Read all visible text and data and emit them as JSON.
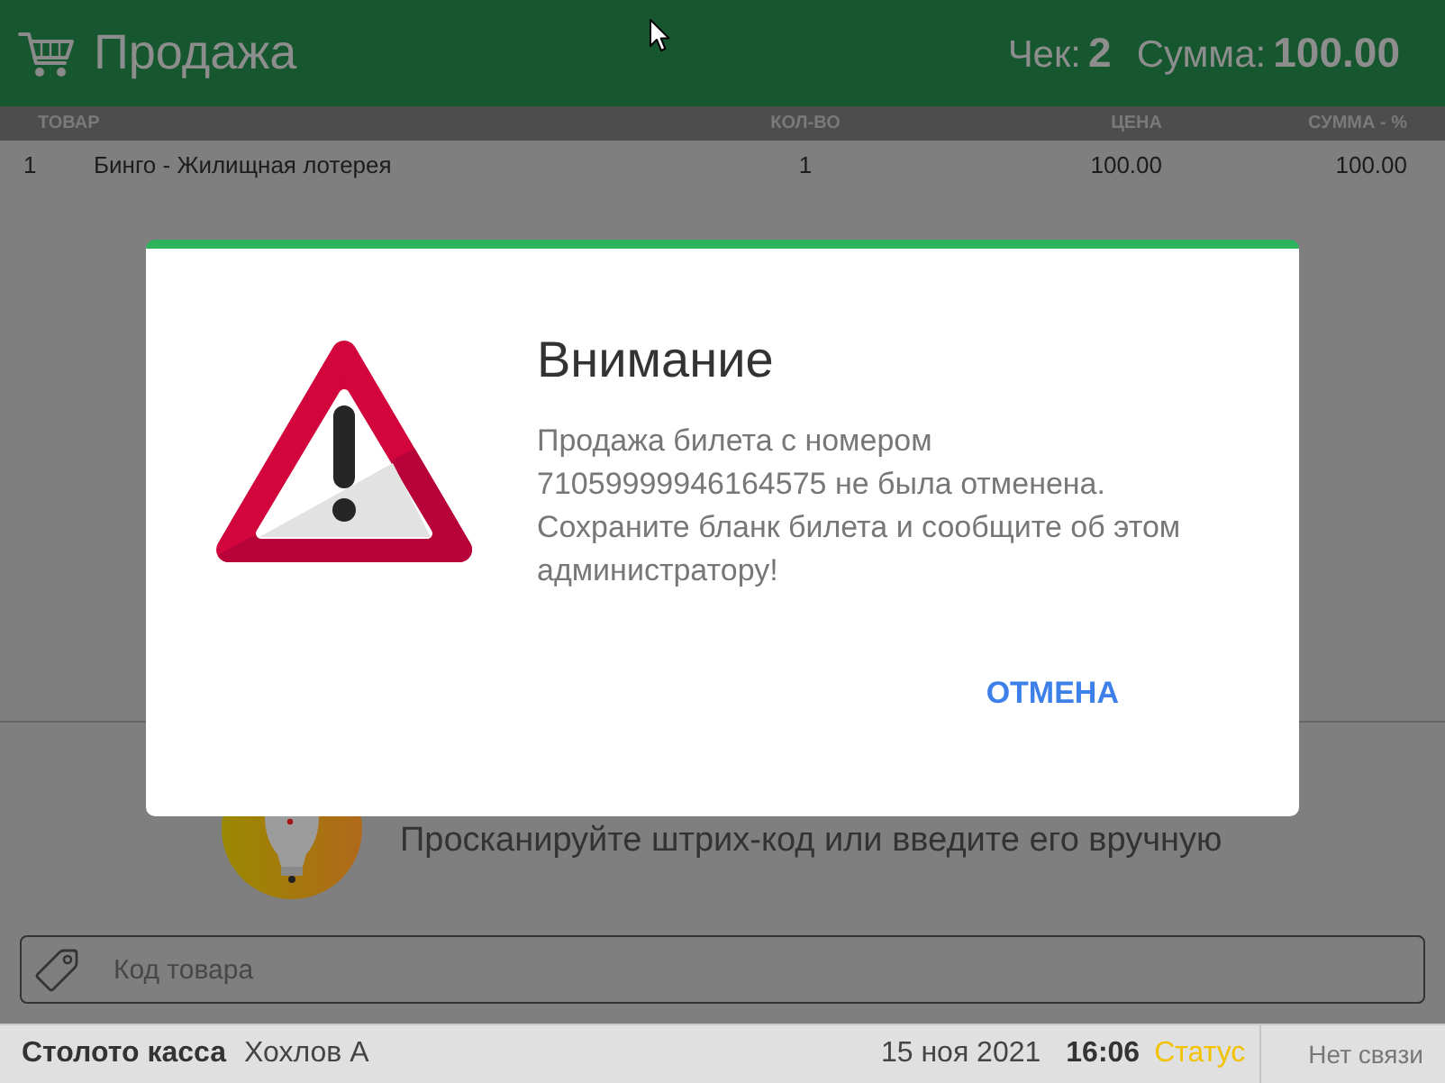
{
  "header": {
    "title": "Продажа",
    "receipt_label": "Чек:",
    "receipt_number": "2",
    "total_label": "Сумма:",
    "total": "100.00"
  },
  "table": {
    "columns": [
      "ТОВАР",
      "КОЛ-ВО",
      "ЦЕНА",
      "СУММА - %"
    ],
    "rows": [
      {
        "number": "1",
        "product": "Бинго - Жилищная лотерея",
        "quantity": "1",
        "price": "100.00",
        "sum": "100.00"
      }
    ]
  },
  "scan_prompt": "Просканируйте штрих-код или введите его вручную",
  "product_code_field": {
    "placeholder": "Код товара"
  },
  "status_bar": {
    "app_name": "Столото касса",
    "cashier": "Хохлов А",
    "date": "15 ноя 2021",
    "time": "16:06",
    "status_link": "Статус",
    "connection": "Нет связи"
  },
  "dialog": {
    "title": "Внимание",
    "message": "Продажа билета с номером 71059999946164575 не была отменена. Сохраните бланк билета и сообщите об этом администратору!",
    "buttons": [
      "ОТМЕНА"
    ]
  }
}
